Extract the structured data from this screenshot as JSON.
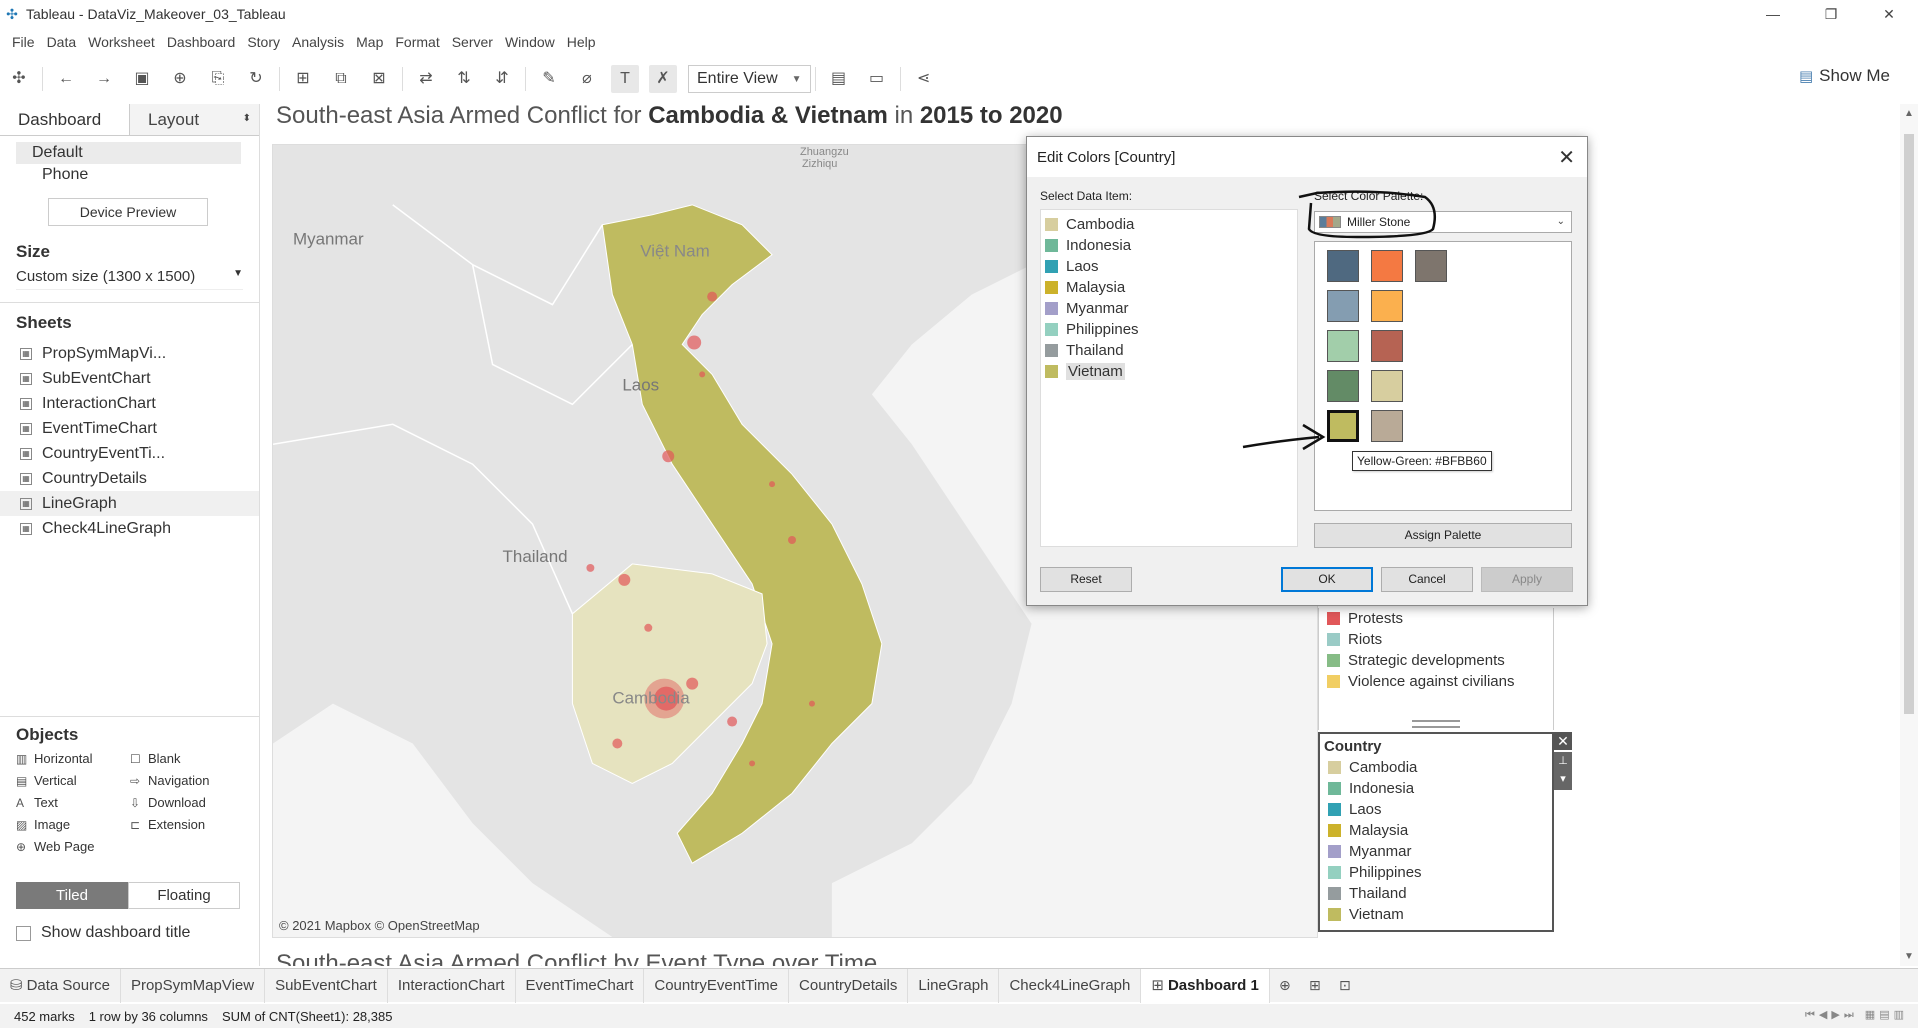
{
  "window": {
    "title": "Tableau - DataViz_Makeover_03_Tableau"
  },
  "menu": [
    "File",
    "Data",
    "Worksheet",
    "Dashboard",
    "Story",
    "Analysis",
    "Map",
    "Format",
    "Server",
    "Window",
    "Help"
  ],
  "toolbar": {
    "view_label": "Entire View",
    "show_me": "Show Me"
  },
  "leftpanel": {
    "tab_dashboard": "Dashboard",
    "tab_layout": "Layout",
    "devices": {
      "default": "Default",
      "phone": "Phone"
    },
    "device_preview": "Device Preview",
    "size_header": "Size",
    "size_value": "Custom size (1300 x 1500)",
    "sheets_header": "Sheets",
    "sheets": [
      "PropSymMapVi...",
      "SubEventChart",
      "InteractionChart",
      "EventTimeChart",
      "CountryEventTi...",
      "CountryDetails",
      "LineGraph",
      "Check4LineGraph"
    ],
    "objects_header": "Objects",
    "objects": [
      "Horizontal",
      "Blank",
      "Vertical",
      "Navigation",
      "Text",
      "Download",
      "Image",
      "Extension",
      "Web Page"
    ],
    "tiled": "Tiled",
    "floating": "Floating",
    "show_title": "Show dashboard title"
  },
  "dashboard": {
    "title_prefix": "South-east Asia Armed Conflict for ",
    "title_countries": "Cambodia & Vietnam",
    "title_mid": " in ",
    "title_years": "2015 to 2020",
    "map_labels": {
      "zhuguzizhiqu1": "Zhuangzu",
      "zhuguzizhiqu2": "Zizhiqu",
      "myanmar": "Myanmar",
      "vietnam": "Việt Nam",
      "laos": "Laos",
      "thailand": "Thailand",
      "cambodia": "Cambodia"
    },
    "credit": "© 2021 Mapbox © OpenStreetMap",
    "subtitle": "South-east Asia Armed Conflict by Event Type over Time"
  },
  "event_legend": {
    "items": [
      {
        "label": "Protests",
        "color": "#E15759"
      },
      {
        "label": "Riots",
        "color": "#9ACBC6"
      },
      {
        "label": "Strategic developments",
        "color": "#86BC86"
      },
      {
        "label": "Violence against civilians",
        "color": "#F1CE63"
      }
    ]
  },
  "country_legend": {
    "header": "Country",
    "items": [
      {
        "label": "Cambodia",
        "color": "#D7CE9F"
      },
      {
        "label": "Indonesia",
        "color": "#6FB899"
      },
      {
        "label": "Laos",
        "color": "#31A1B3"
      },
      {
        "label": "Malaysia",
        "color": "#CCB22B"
      },
      {
        "label": "Myanmar",
        "color": "#A39FC9"
      },
      {
        "label": "Philippines",
        "color": "#94D0C0"
      },
      {
        "label": "Thailand",
        "color": "#959C9E"
      },
      {
        "label": "Vietnam",
        "color": "#BFBB60"
      }
    ]
  },
  "dialog": {
    "title": "Edit Colors [Country]",
    "select_item_label": "Select Data Item:",
    "select_palette_label": "Select Color Palette:",
    "palette_value": "Miller Stone",
    "tooltip": "Yellow-Green: #BFBB60",
    "assign": "Assign Palette",
    "reset": "Reset",
    "ok": "OK",
    "cancel": "Cancel",
    "apply": "Apply",
    "palette_colors": [
      "#4F6980",
      "#F47942",
      "#7E756D",
      "#849DB1",
      "#FBB04E",
      "#A2CEAA",
      "#B66353",
      "#638B66",
      "#D7CE9F",
      "#BFBB60",
      "#B9AA97"
    ]
  },
  "bottom_tabs": [
    "Data Source",
    "PropSymMapView",
    "SubEventChart",
    "InteractionChart",
    "EventTimeChart",
    "CountryEventTime",
    "CountryDetails",
    "LineGraph",
    "Check4LineGraph",
    "Dashboard 1"
  ],
  "status": {
    "marks": "452 marks",
    "rows": "1 row by 36 columns",
    "sum": "SUM of CNT(Sheet1): 28,385"
  }
}
